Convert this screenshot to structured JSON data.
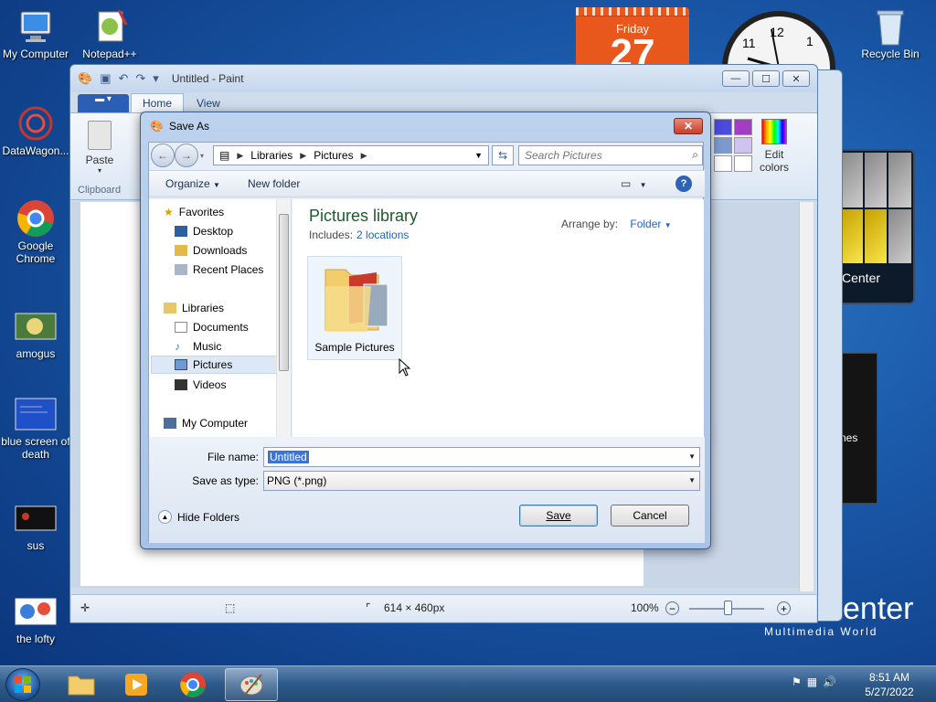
{
  "desktop": {
    "icons": [
      {
        "label": "My Computer"
      },
      {
        "label": "Notepad++"
      },
      {
        "label": "DataWagon..."
      },
      {
        "label": "Google Chrome"
      },
      {
        "label": "amogus"
      },
      {
        "label": "blue screen of death"
      },
      {
        "label": "sus"
      },
      {
        "label": "the lofty"
      },
      {
        "label": "Recycle Bin"
      }
    ],
    "calendar": {
      "day": "Friday",
      "date": "27"
    },
    "media_center": {
      "label": "Center",
      "partial_label": "nes",
      "title": "enter",
      "subtitle": "Multimedia World"
    }
  },
  "paint": {
    "title": "Untitled - Paint",
    "tabs": {
      "home": "Home",
      "view": "View"
    },
    "paste_label": "Paste",
    "clipboard_group": "Clipboard",
    "edit_colors": "Edit colors",
    "status": {
      "dimensions": "614 × 460px",
      "zoom": "100%"
    },
    "swatches": [
      "#4b4bdc",
      "#a23ec4",
      "#7d9ad0",
      "#cfc3f0",
      "#ffffff",
      "#ffffff"
    ]
  },
  "dialog": {
    "title": "Save As",
    "address": {
      "crumbs": [
        "Libraries",
        "Pictures"
      ]
    },
    "search_placeholder": "Search Pictures",
    "toolbar": {
      "organize": "Organize",
      "new_folder": "New folder"
    },
    "nav": {
      "favorites": "Favorites",
      "desktop": "Desktop",
      "downloads": "Downloads",
      "recent": "Recent Places",
      "libraries": "Libraries",
      "documents": "Documents",
      "music": "Music",
      "pictures": "Pictures",
      "videos": "Videos",
      "computer": "My Computer"
    },
    "library": {
      "title": "Pictures library",
      "includes_label": "Includes:",
      "includes_link": "2 locations",
      "arrange_label": "Arrange by:",
      "arrange_value": "Folder"
    },
    "folder_item": "Sample Pictures",
    "file_name_label": "File name:",
    "file_name_value": "Untitled",
    "save_type_label": "Save as type:",
    "save_type_value": "PNG (*.png)",
    "hide_folders": "Hide Folders",
    "save": "Save",
    "cancel": "Cancel"
  },
  "taskbar": {
    "time": "8:51 AM",
    "date": "5/27/2022"
  },
  "colors": {
    "accent": "#1f63c4",
    "library_title": "#1e5a2a",
    "selection": "#3875d7"
  }
}
